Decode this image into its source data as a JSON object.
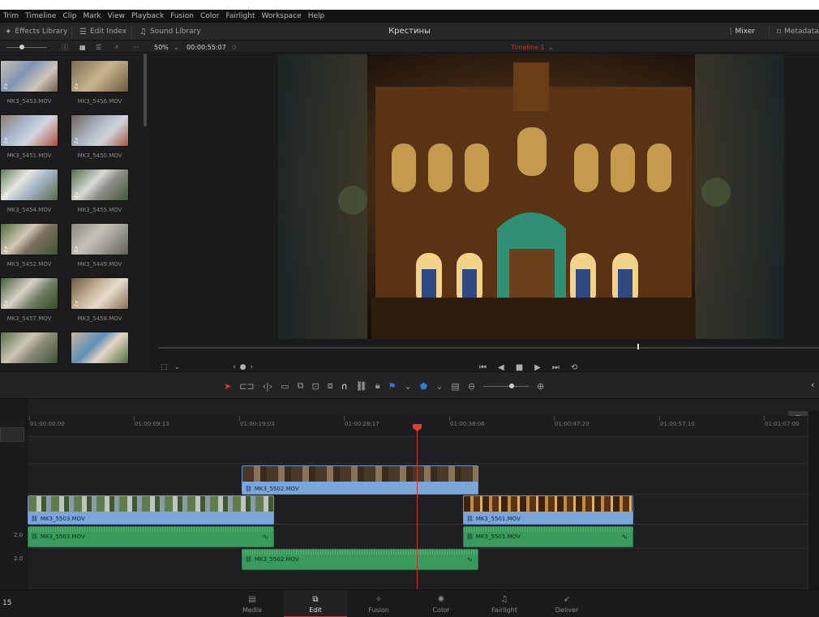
{
  "menu": [
    "Trim",
    "Timeline",
    "Clip",
    "Mark",
    "View",
    "Playback",
    "Fusion",
    "Color",
    "Fairlight",
    "Workspace",
    "Help"
  ],
  "toolbar": {
    "effects_library": "Effects Library",
    "edit_index": "Edit Index",
    "sound_library": "Sound Library",
    "project_title": "Крестины",
    "mixer": "Mixer",
    "metadata": "Metadata"
  },
  "subbar": {
    "zoom": "50%",
    "timecode": "00:00:55:07",
    "timeline_name": "Timeline 1"
  },
  "media_pool": {
    "clips": [
      "MK3_5453.MOV",
      "MK3_5456.MOV",
      "MK3_5451.MOV",
      "MK3_5450.MOV",
      "MK3_5454.MOV",
      "MK3_5455.MOV",
      "MK3_5452.MOV",
      "MK3_5449.MOV",
      "MK3_5457.MOV",
      "MK3_5458.MOV"
    ]
  },
  "timeline": {
    "ruler": [
      "01:00:00:00",
      "01:00:09:13",
      "01:00:19:03",
      "01:00:28:17",
      "01:00:38:06",
      "01:00:47:20",
      "01:00:57:10",
      "01:01:07:00"
    ],
    "audio_track_1_level": "2.0",
    "audio_track_2_level": "2.0",
    "clips": {
      "v2_clip": "MK3_5502.MOV",
      "v1_clip_a": "MK3_5503.MOV",
      "v1_clip_b": "MK3_5501.MOV",
      "a1_clip_a": "MK3_5503.MOV",
      "a1_clip_b": "MK3_5501.MOV",
      "a2_clip": "MK3_5502.MOV"
    }
  },
  "status": {
    "left_number": "15"
  },
  "pages": [
    "Media",
    "Edit",
    "Fusion",
    "Color",
    "Fairlight",
    "Deliver"
  ],
  "colors": {
    "accent_red": "#e03c32",
    "video_clip": "#7aa6d9",
    "audio_clip": "#3a9a5e"
  }
}
